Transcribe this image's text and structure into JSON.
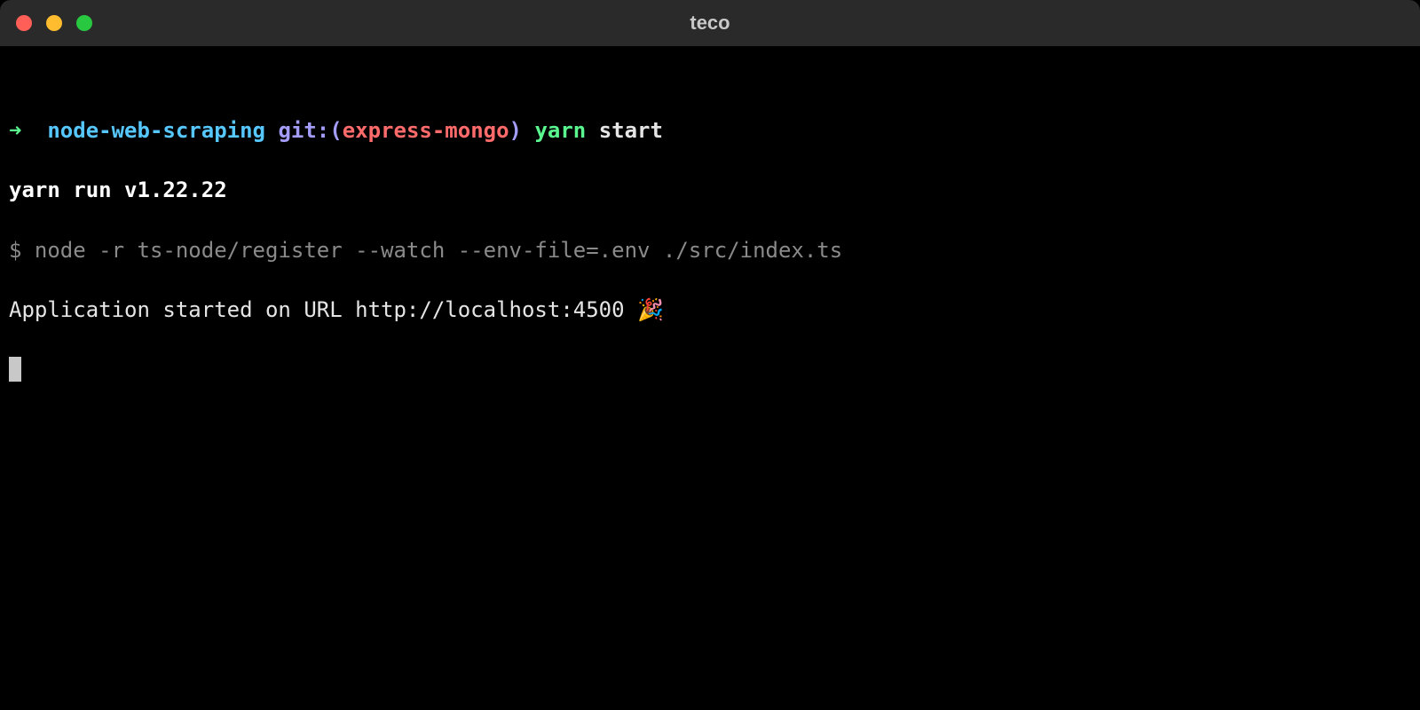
{
  "titlebar": {
    "title": "teco"
  },
  "prompt": {
    "arrow": "➜",
    "dir": "node-web-scraping",
    "git_label": "git:(",
    "git_branch": "express-mongo",
    "git_close": ")",
    "command": "yarn",
    "arg": "start"
  },
  "output": {
    "yarn_run": "yarn run v1.22.22",
    "dollar": "$",
    "node_cmd": "node -r ts-node/register --watch --env-file=.env ./src/index.ts",
    "app_started": "Application started on URL http://localhost:4500 🎉"
  }
}
